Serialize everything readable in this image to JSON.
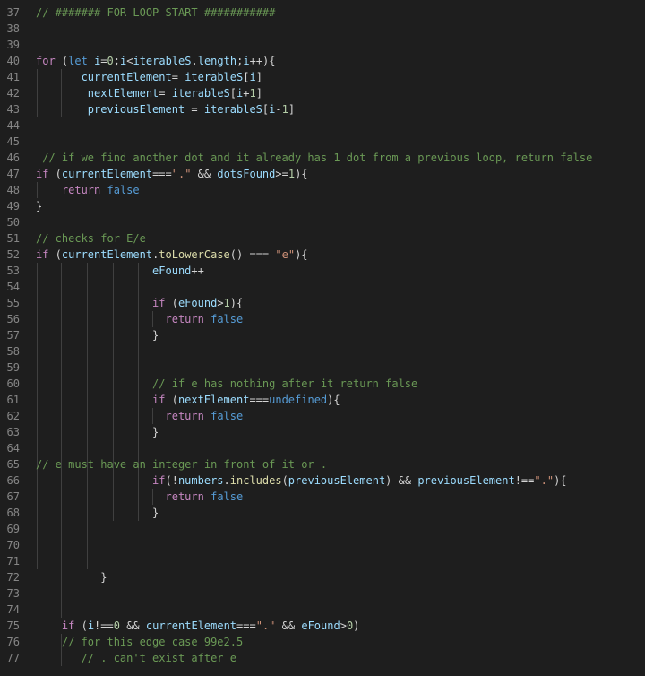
{
  "editor": {
    "lines": [
      {
        "n": "37",
        "t": [
          [
            "comment",
            "// ####### FOR LOOP START ###########"
          ]
        ]
      },
      {
        "n": "38",
        "t": []
      },
      {
        "n": "39",
        "t": []
      },
      {
        "n": "40",
        "t": [
          [
            "keyword",
            "for"
          ],
          [
            "punct",
            " ("
          ],
          [
            "storage",
            "let"
          ],
          [
            "plain",
            " "
          ],
          [
            "variable",
            "i"
          ],
          [
            "operator",
            "="
          ],
          [
            "number",
            "0"
          ],
          [
            "punct",
            ";"
          ],
          [
            "variable",
            "i"
          ],
          [
            "operator",
            "<"
          ],
          [
            "variable",
            "iterableS"
          ],
          [
            "punct",
            "."
          ],
          [
            "variable",
            "length"
          ],
          [
            "punct",
            ";"
          ],
          [
            "variable",
            "i"
          ],
          [
            "operator",
            "++"
          ],
          [
            "punct",
            "){"
          ]
        ]
      },
      {
        "n": "41",
        "t": [
          [
            "plain",
            "       "
          ],
          [
            "variable",
            "currentElement"
          ],
          [
            "operator",
            "="
          ],
          [
            "plain",
            " "
          ],
          [
            "variable",
            "iterableS"
          ],
          [
            "punct",
            "["
          ],
          [
            "variable",
            "i"
          ],
          [
            "punct",
            "]"
          ]
        ]
      },
      {
        "n": "42",
        "t": [
          [
            "plain",
            "        "
          ],
          [
            "variable",
            "nextElement"
          ],
          [
            "operator",
            "="
          ],
          [
            "plain",
            " "
          ],
          [
            "variable",
            "iterableS"
          ],
          [
            "punct",
            "["
          ],
          [
            "variable",
            "i"
          ],
          [
            "operator",
            "+"
          ],
          [
            "number",
            "1"
          ],
          [
            "punct",
            "]"
          ]
        ]
      },
      {
        "n": "43",
        "t": [
          [
            "plain",
            "        "
          ],
          [
            "variable",
            "previousElement"
          ],
          [
            "plain",
            " "
          ],
          [
            "operator",
            "="
          ],
          [
            "plain",
            " "
          ],
          [
            "variable",
            "iterableS"
          ],
          [
            "punct",
            "["
          ],
          [
            "variable",
            "i"
          ],
          [
            "operator",
            "-"
          ],
          [
            "number",
            "1"
          ],
          [
            "punct",
            "]"
          ]
        ]
      },
      {
        "n": "44",
        "t": []
      },
      {
        "n": "45",
        "t": []
      },
      {
        "n": "46",
        "t": [
          [
            "comment",
            " // if we find another dot and it already has 1 dot from a previous loop, return false"
          ]
        ]
      },
      {
        "n": "47",
        "t": [
          [
            "keyword",
            "if"
          ],
          [
            "punct",
            " ("
          ],
          [
            "variable",
            "currentElement"
          ],
          [
            "operator",
            "==="
          ],
          [
            "string",
            "\".\""
          ],
          [
            "plain",
            " "
          ],
          [
            "operator",
            "&&"
          ],
          [
            "plain",
            " "
          ],
          [
            "variable",
            "dotsFound"
          ],
          [
            "operator",
            ">="
          ],
          [
            "number",
            "1"
          ],
          [
            "punct",
            "){"
          ]
        ]
      },
      {
        "n": "48",
        "t": [
          [
            "plain",
            "    "
          ],
          [
            "keyword",
            "return"
          ],
          [
            "plain",
            " "
          ],
          [
            "constant",
            "false"
          ]
        ]
      },
      {
        "n": "49",
        "t": [
          [
            "punct",
            "}"
          ]
        ]
      },
      {
        "n": "50",
        "t": []
      },
      {
        "n": "51",
        "t": [
          [
            "comment",
            "// checks for E/e"
          ]
        ]
      },
      {
        "n": "52",
        "t": [
          [
            "keyword",
            "if"
          ],
          [
            "punct",
            " ("
          ],
          [
            "variable",
            "currentElement"
          ],
          [
            "punct",
            "."
          ],
          [
            "function",
            "toLowerCase"
          ],
          [
            "punct",
            "()"
          ],
          [
            "plain",
            " "
          ],
          [
            "operator",
            "==="
          ],
          [
            "plain",
            " "
          ],
          [
            "string",
            "\"e\""
          ],
          [
            "punct",
            "){"
          ]
        ]
      },
      {
        "n": "53",
        "t": [
          [
            "plain",
            "                  "
          ],
          [
            "variable",
            "eFound"
          ],
          [
            "operator",
            "++"
          ]
        ]
      },
      {
        "n": "54",
        "t": []
      },
      {
        "n": "55",
        "t": [
          [
            "plain",
            "                  "
          ],
          [
            "keyword",
            "if"
          ],
          [
            "punct",
            " ("
          ],
          [
            "variable",
            "eFound"
          ],
          [
            "operator",
            ">"
          ],
          [
            "number",
            "1"
          ],
          [
            "punct",
            "){"
          ]
        ]
      },
      {
        "n": "56",
        "t": [
          [
            "plain",
            "                    "
          ],
          [
            "keyword",
            "return"
          ],
          [
            "plain",
            " "
          ],
          [
            "constant",
            "false"
          ]
        ]
      },
      {
        "n": "57",
        "t": [
          [
            "plain",
            "                  "
          ],
          [
            "punct",
            "}"
          ]
        ]
      },
      {
        "n": "58",
        "t": []
      },
      {
        "n": "59",
        "t": []
      },
      {
        "n": "60",
        "t": [
          [
            "plain",
            "                  "
          ],
          [
            "comment",
            "// if e has nothing after it return false"
          ]
        ]
      },
      {
        "n": "61",
        "t": [
          [
            "plain",
            "                  "
          ],
          [
            "keyword",
            "if"
          ],
          [
            "punct",
            " ("
          ],
          [
            "variable",
            "nextElement"
          ],
          [
            "operator",
            "==="
          ],
          [
            "constant",
            "undefined"
          ],
          [
            "punct",
            "){"
          ]
        ]
      },
      {
        "n": "62",
        "t": [
          [
            "plain",
            "                    "
          ],
          [
            "keyword",
            "return"
          ],
          [
            "plain",
            " "
          ],
          [
            "constant",
            "false"
          ]
        ]
      },
      {
        "n": "63",
        "t": [
          [
            "plain",
            "                  "
          ],
          [
            "punct",
            "}"
          ]
        ]
      },
      {
        "n": "64",
        "t": []
      },
      {
        "n": "65",
        "t": [
          [
            "comment",
            "// e must have an integer in front of it or ."
          ]
        ]
      },
      {
        "n": "66",
        "t": [
          [
            "plain",
            "                  "
          ],
          [
            "keyword",
            "if"
          ],
          [
            "punct",
            "(!"
          ],
          [
            "variable",
            "numbers"
          ],
          [
            "punct",
            "."
          ],
          [
            "function",
            "includes"
          ],
          [
            "punct",
            "("
          ],
          [
            "variable",
            "previousElement"
          ],
          [
            "punct",
            ")"
          ],
          [
            "plain",
            " "
          ],
          [
            "operator",
            "&&"
          ],
          [
            "plain",
            " "
          ],
          [
            "variable",
            "previousElement"
          ],
          [
            "operator",
            "!=="
          ],
          [
            "string",
            "\".\""
          ],
          [
            "punct",
            "){"
          ]
        ]
      },
      {
        "n": "67",
        "t": [
          [
            "plain",
            "                    "
          ],
          [
            "keyword",
            "return"
          ],
          [
            "plain",
            " "
          ],
          [
            "constant",
            "false"
          ]
        ]
      },
      {
        "n": "68",
        "t": [
          [
            "plain",
            "                  "
          ],
          [
            "punct",
            "}"
          ]
        ]
      },
      {
        "n": "69",
        "t": []
      },
      {
        "n": "70",
        "t": []
      },
      {
        "n": "71",
        "t": []
      },
      {
        "n": "72",
        "t": [
          [
            "plain",
            "          "
          ],
          [
            "punct",
            "}"
          ]
        ]
      },
      {
        "n": "73",
        "t": []
      },
      {
        "n": "74",
        "t": []
      },
      {
        "n": "75",
        "t": [
          [
            "plain",
            "    "
          ],
          [
            "keyword",
            "if"
          ],
          [
            "punct",
            " ("
          ],
          [
            "variable",
            "i"
          ],
          [
            "operator",
            "!=="
          ],
          [
            "number",
            "0"
          ],
          [
            "plain",
            " "
          ],
          [
            "operator",
            "&&"
          ],
          [
            "plain",
            " "
          ],
          [
            "variable",
            "currentElement"
          ],
          [
            "operator",
            "==="
          ],
          [
            "string",
            "\".\""
          ],
          [
            "plain",
            " "
          ],
          [
            "operator",
            "&&"
          ],
          [
            "plain",
            " "
          ],
          [
            "variable",
            "eFound"
          ],
          [
            "operator",
            ">"
          ],
          [
            "number",
            "0"
          ],
          [
            "punct",
            ")"
          ]
        ]
      },
      {
        "n": "76",
        "t": [
          [
            "plain",
            "    "
          ],
          [
            "comment",
            "// for this edge case 99e2.5"
          ]
        ]
      },
      {
        "n": "77",
        "t": [
          [
            "plain",
            "       "
          ],
          [
            "comment",
            "// . can't exist after e"
          ]
        ]
      }
    ]
  }
}
